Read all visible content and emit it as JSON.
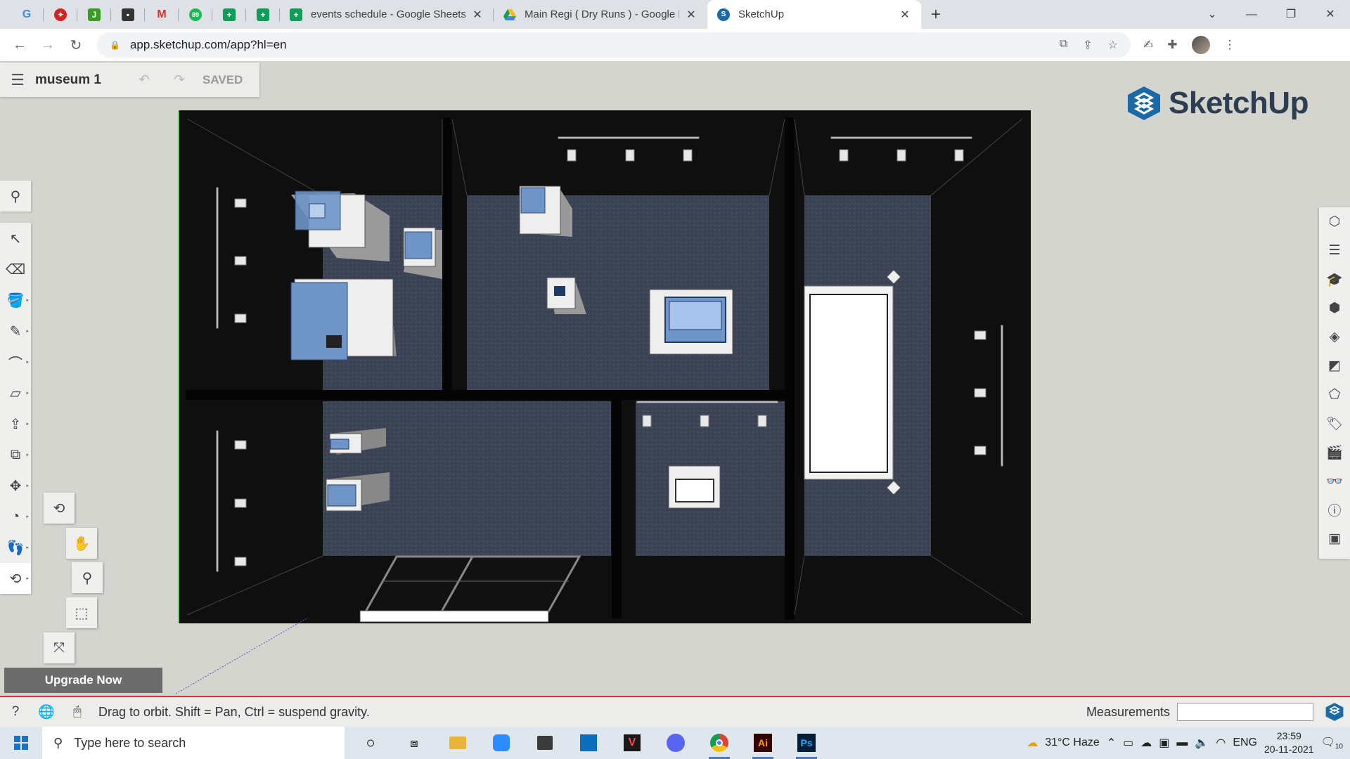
{
  "browser": {
    "tabs": [
      {
        "title": "events schedule - Google Sheets",
        "icon": "sheets-icon"
      },
      {
        "title": "Main Regi ( Dry Runs ) - Google D",
        "icon": "drive-icon"
      },
      {
        "title": "SketchUp",
        "icon": "sketchup-icon",
        "active": true
      }
    ],
    "url": "app.sketchup.com/app?hl=en"
  },
  "app": {
    "file_name": "museum 1",
    "save_state": "SAVED",
    "brand": "SketchUp",
    "upgrade_label": "Upgrade Now",
    "status_hint": "Drag to orbit. Shift = Pan, Ctrl = suspend gravity.",
    "measurements_label": "Measurements",
    "measurements_value": ""
  },
  "taskbar": {
    "search_placeholder": "Type here to search",
    "weather": "31°C  Haze",
    "language": "ENG",
    "time": "23:59",
    "date": "20-11-2021",
    "notifications": "10"
  },
  "colors": {
    "sketchup_blue": "#1a6aa8",
    "walls": "#0f0f0f",
    "carpet": "#3b4354",
    "glass": "#6f95c8"
  }
}
